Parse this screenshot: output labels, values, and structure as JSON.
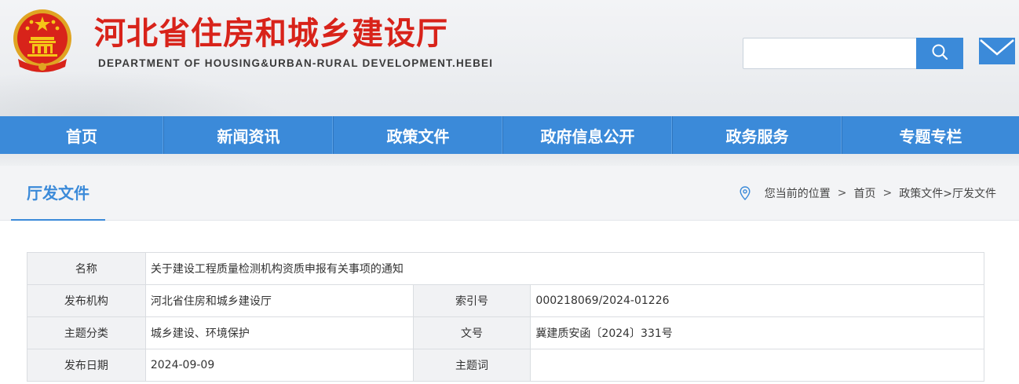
{
  "header": {
    "title": "河北省住房和城乡建设厅",
    "subtitle": "DEPARTMENT OF HOUSING&URBAN-RURAL DEVELOPMENT.HEBEI",
    "search": {
      "placeholder": "",
      "value": ""
    },
    "icons": {
      "emblem": "national-emblem-icon",
      "search": "search-icon",
      "mail": "mail-icon"
    },
    "colors": {
      "title": "#d8231a",
      "accent": "#3b8ad9"
    }
  },
  "nav": {
    "items": [
      {
        "label": "首页"
      },
      {
        "label": "新闻资讯"
      },
      {
        "label": "政策文件"
      },
      {
        "label": "政府信息公开"
      },
      {
        "label": "政务服务"
      },
      {
        "label": "专题专栏"
      }
    ]
  },
  "section": {
    "title": "厅发文件"
  },
  "breadcrumb": {
    "prefix": "您当前的位置",
    "sep": ">",
    "home": "首页",
    "trail": "政策文件>厅发文件"
  },
  "info": {
    "name_label": "名称",
    "name_value": "关于建设工程质量检测机构资质申报有关事项的通知",
    "publisher_label": "发布机构",
    "publisher_value": "河北省住房和城乡建设厅",
    "index_label": "索引号",
    "index_value": "000218069/2024-01226",
    "topic_label": "主题分类",
    "topic_value": "城乡建设、环境保护",
    "docno_label": "文号",
    "docno_value": "冀建质安函〔2024〕331号",
    "date_label": "发布日期",
    "date_value": "2024-09-09",
    "keyword_label": "主题词",
    "keyword_value": ""
  }
}
